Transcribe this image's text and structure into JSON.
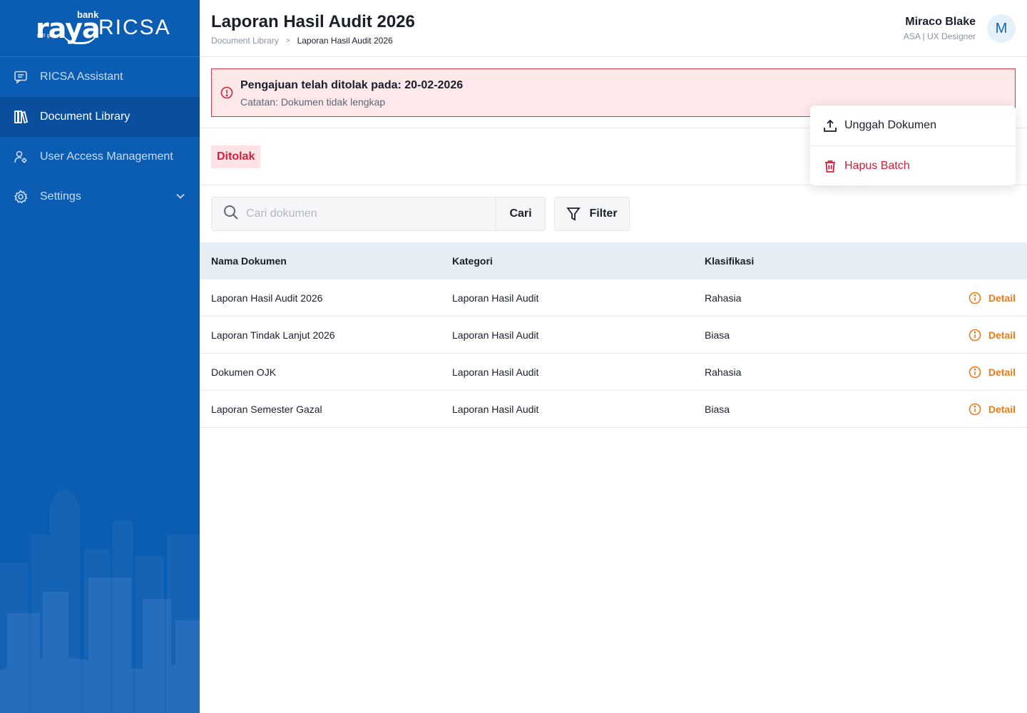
{
  "brand": {
    "bank": "bank",
    "raya": "raya",
    "ricsa": "RICSA",
    "group": "BRI group"
  },
  "sidebar": {
    "items": [
      {
        "label": "RICSA Assistant",
        "icon": "chat-icon",
        "active": false
      },
      {
        "label": "Document Library",
        "icon": "library-icon",
        "active": true
      },
      {
        "label": "User Access Management",
        "icon": "user-gear-icon",
        "active": false
      },
      {
        "label": "Settings",
        "icon": "gear-icon",
        "active": false
      }
    ]
  },
  "header": {
    "title": "Laporan Hasil Audit 2026",
    "breadcrumb": [
      "Document Library",
      "Laporan Hasil Audit 2026"
    ],
    "breadcrumb_sep": ">",
    "user": {
      "name": "Miraco Blake",
      "role": "ASA | UX Designer",
      "initial": "M"
    }
  },
  "alert": {
    "title": "Pengajuan telah ditolak pada: 20-02-2026",
    "note": "Catatan: Dokumen tidak lengkap"
  },
  "status": {
    "label": "Ditolak"
  },
  "menu": {
    "upload": "Unggah Dokumen",
    "delete": "Hapus Batch"
  },
  "search": {
    "placeholder": "Cari dokumen",
    "value": "",
    "button": "Cari"
  },
  "filter": {
    "label": "Filter"
  },
  "table": {
    "headers": [
      "Nama Dokumen",
      "Kategori",
      "Klasifikasi"
    ],
    "action_label": "Detail",
    "rows": [
      {
        "name": "Laporan Hasil Audit 2026",
        "category": "Laporan Hasil Audit",
        "classification": "Rahasia"
      },
      {
        "name": "Laporan Tindak Lanjut 2026",
        "category": "Laporan Hasil Audit",
        "classification": "Biasa"
      },
      {
        "name": "Dokumen OJK",
        "category": "Laporan Hasil Audit",
        "classification": "Rahasia"
      },
      {
        "name": "Laporan Semester Gazal",
        "category": "Laporan Hasil Audit",
        "classification": "Biasa"
      }
    ]
  },
  "colors": {
    "sidebar": "#0b5cb3",
    "accent_orange": "#ee7a1a",
    "danger": "#d0203a",
    "alert_bg": "#fde8ea"
  }
}
